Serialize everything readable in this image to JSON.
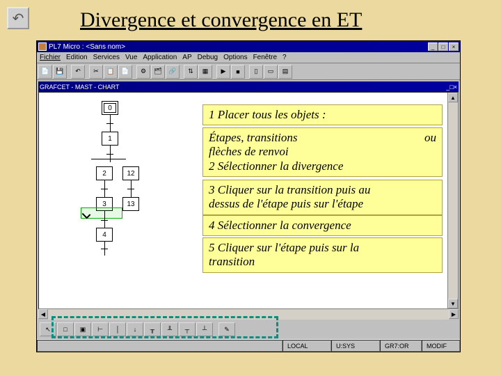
{
  "slide_title": "Divergence et convergence en ET",
  "app": {
    "window_title": "PL7 Micro : <Sans nom>",
    "menus": [
      "Fichier",
      "Edition",
      "Services",
      "Vue",
      "Application",
      "AP",
      "Debug",
      "Options",
      "Fenêtre",
      "?"
    ],
    "doc_title": "GRAFCET - MAST - CHART"
  },
  "steps": {
    "s0": "0",
    "s1": "1",
    "s2": "2",
    "s12": "12",
    "s3": "3",
    "s13": "13",
    "s4": "4"
  },
  "status": {
    "mode": "LOCAL",
    "sys": "U:SYS",
    "grid": "GR7:OR",
    "edit": "MODIF"
  },
  "instructions": {
    "c1_l1": "1 Placer tous les objets :",
    "c2_l1": "Étapes, transitions",
    "c2_l1_suffix": "ou",
    "c2_l2": "flèches de renvoi",
    "c2_l3": "2 Sélectionner la divergence",
    "c3_l1": "3 Cliquer sur la transition puis au",
    "c3_l2": "dessus de l'étape puis sur l'étape",
    "c4_l1": "4 Sélectionner la convergence",
    "c5_l1": "5 Cliquer sur l'étape puis sur la",
    "c5_l2": "transition"
  }
}
